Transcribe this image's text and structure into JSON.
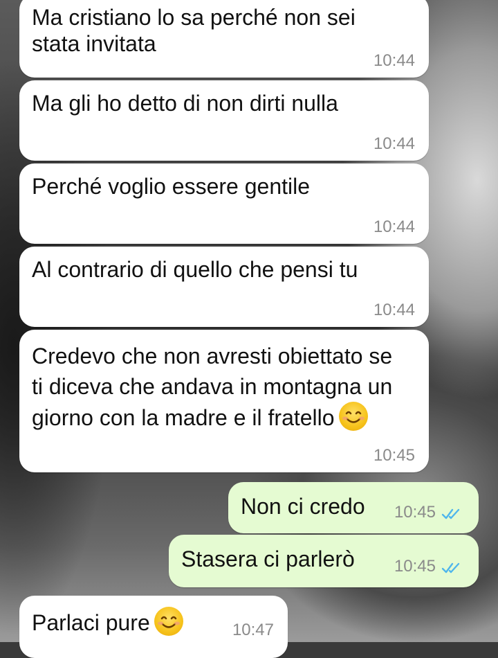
{
  "messages": [
    {
      "side": "in",
      "text": "Ma cristiano lo sa perché non sei stata invitata",
      "time": "10:44"
    },
    {
      "side": "in",
      "text": "Ma gli ho detto di non dirti nulla",
      "time": "10:44"
    },
    {
      "side": "in",
      "text": "Perché voglio essere gentile",
      "time": "10:44"
    },
    {
      "side": "in",
      "text": "Al contrario di quello che pensi tu",
      "time": "10:44"
    },
    {
      "side": "in",
      "text": "Credevo che non avresti obiettato se ti diceva che andava in montagna un giorno con la madre e il fratello",
      "time": "10:45",
      "emoji": "smiling-face"
    },
    {
      "side": "out",
      "text": "Non ci credo",
      "time": "10:45",
      "status": "read"
    },
    {
      "side": "out",
      "text": "Stasera ci parlerò",
      "time": "10:45",
      "status": "read"
    },
    {
      "side": "in",
      "text": "Parlaci pure",
      "time": "10:47",
      "emoji": "smiling-face"
    }
  ],
  "colors": {
    "incoming": "#ffffff",
    "outgoing": "#e5fbd2",
    "read_ticks": "#4fb6ec",
    "time": "#8a8a8a"
  }
}
